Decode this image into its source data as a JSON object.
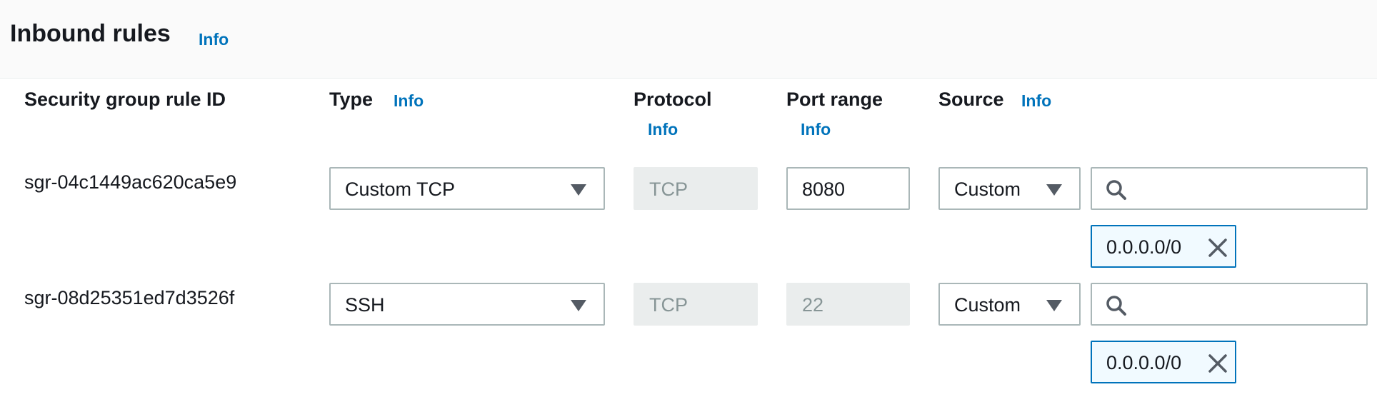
{
  "header": {
    "title": "Inbound rules",
    "info": "Info"
  },
  "columns": {
    "rule_id": "Security group rule ID",
    "type": "Type",
    "type_info": "Info",
    "protocol": "Protocol",
    "protocol_info": "Info",
    "port_range": "Port range",
    "port_info": "Info",
    "source": "Source",
    "source_info": "Info"
  },
  "rules": [
    {
      "id": "sgr-04c1449ac620ca5e9",
      "type": "Custom TCP",
      "protocol": "TCP",
      "port": "8080",
      "source_type": "Custom",
      "search_value": "",
      "cidr": "0.0.0.0/0"
    },
    {
      "id": "sgr-08d25351ed7d3526f",
      "type": "SSH",
      "protocol": "TCP",
      "port": "22",
      "source_type": "Custom",
      "search_value": "",
      "cidr": "0.0.0.0/0"
    }
  ],
  "icons": {
    "dropdown": "caret-down-icon",
    "search": "search-icon",
    "remove": "close-icon"
  },
  "colors": {
    "link": "#0073bb",
    "token_border": "#0073bb",
    "token_bg": "#f1faff",
    "disabled_bg": "#eaeded"
  }
}
